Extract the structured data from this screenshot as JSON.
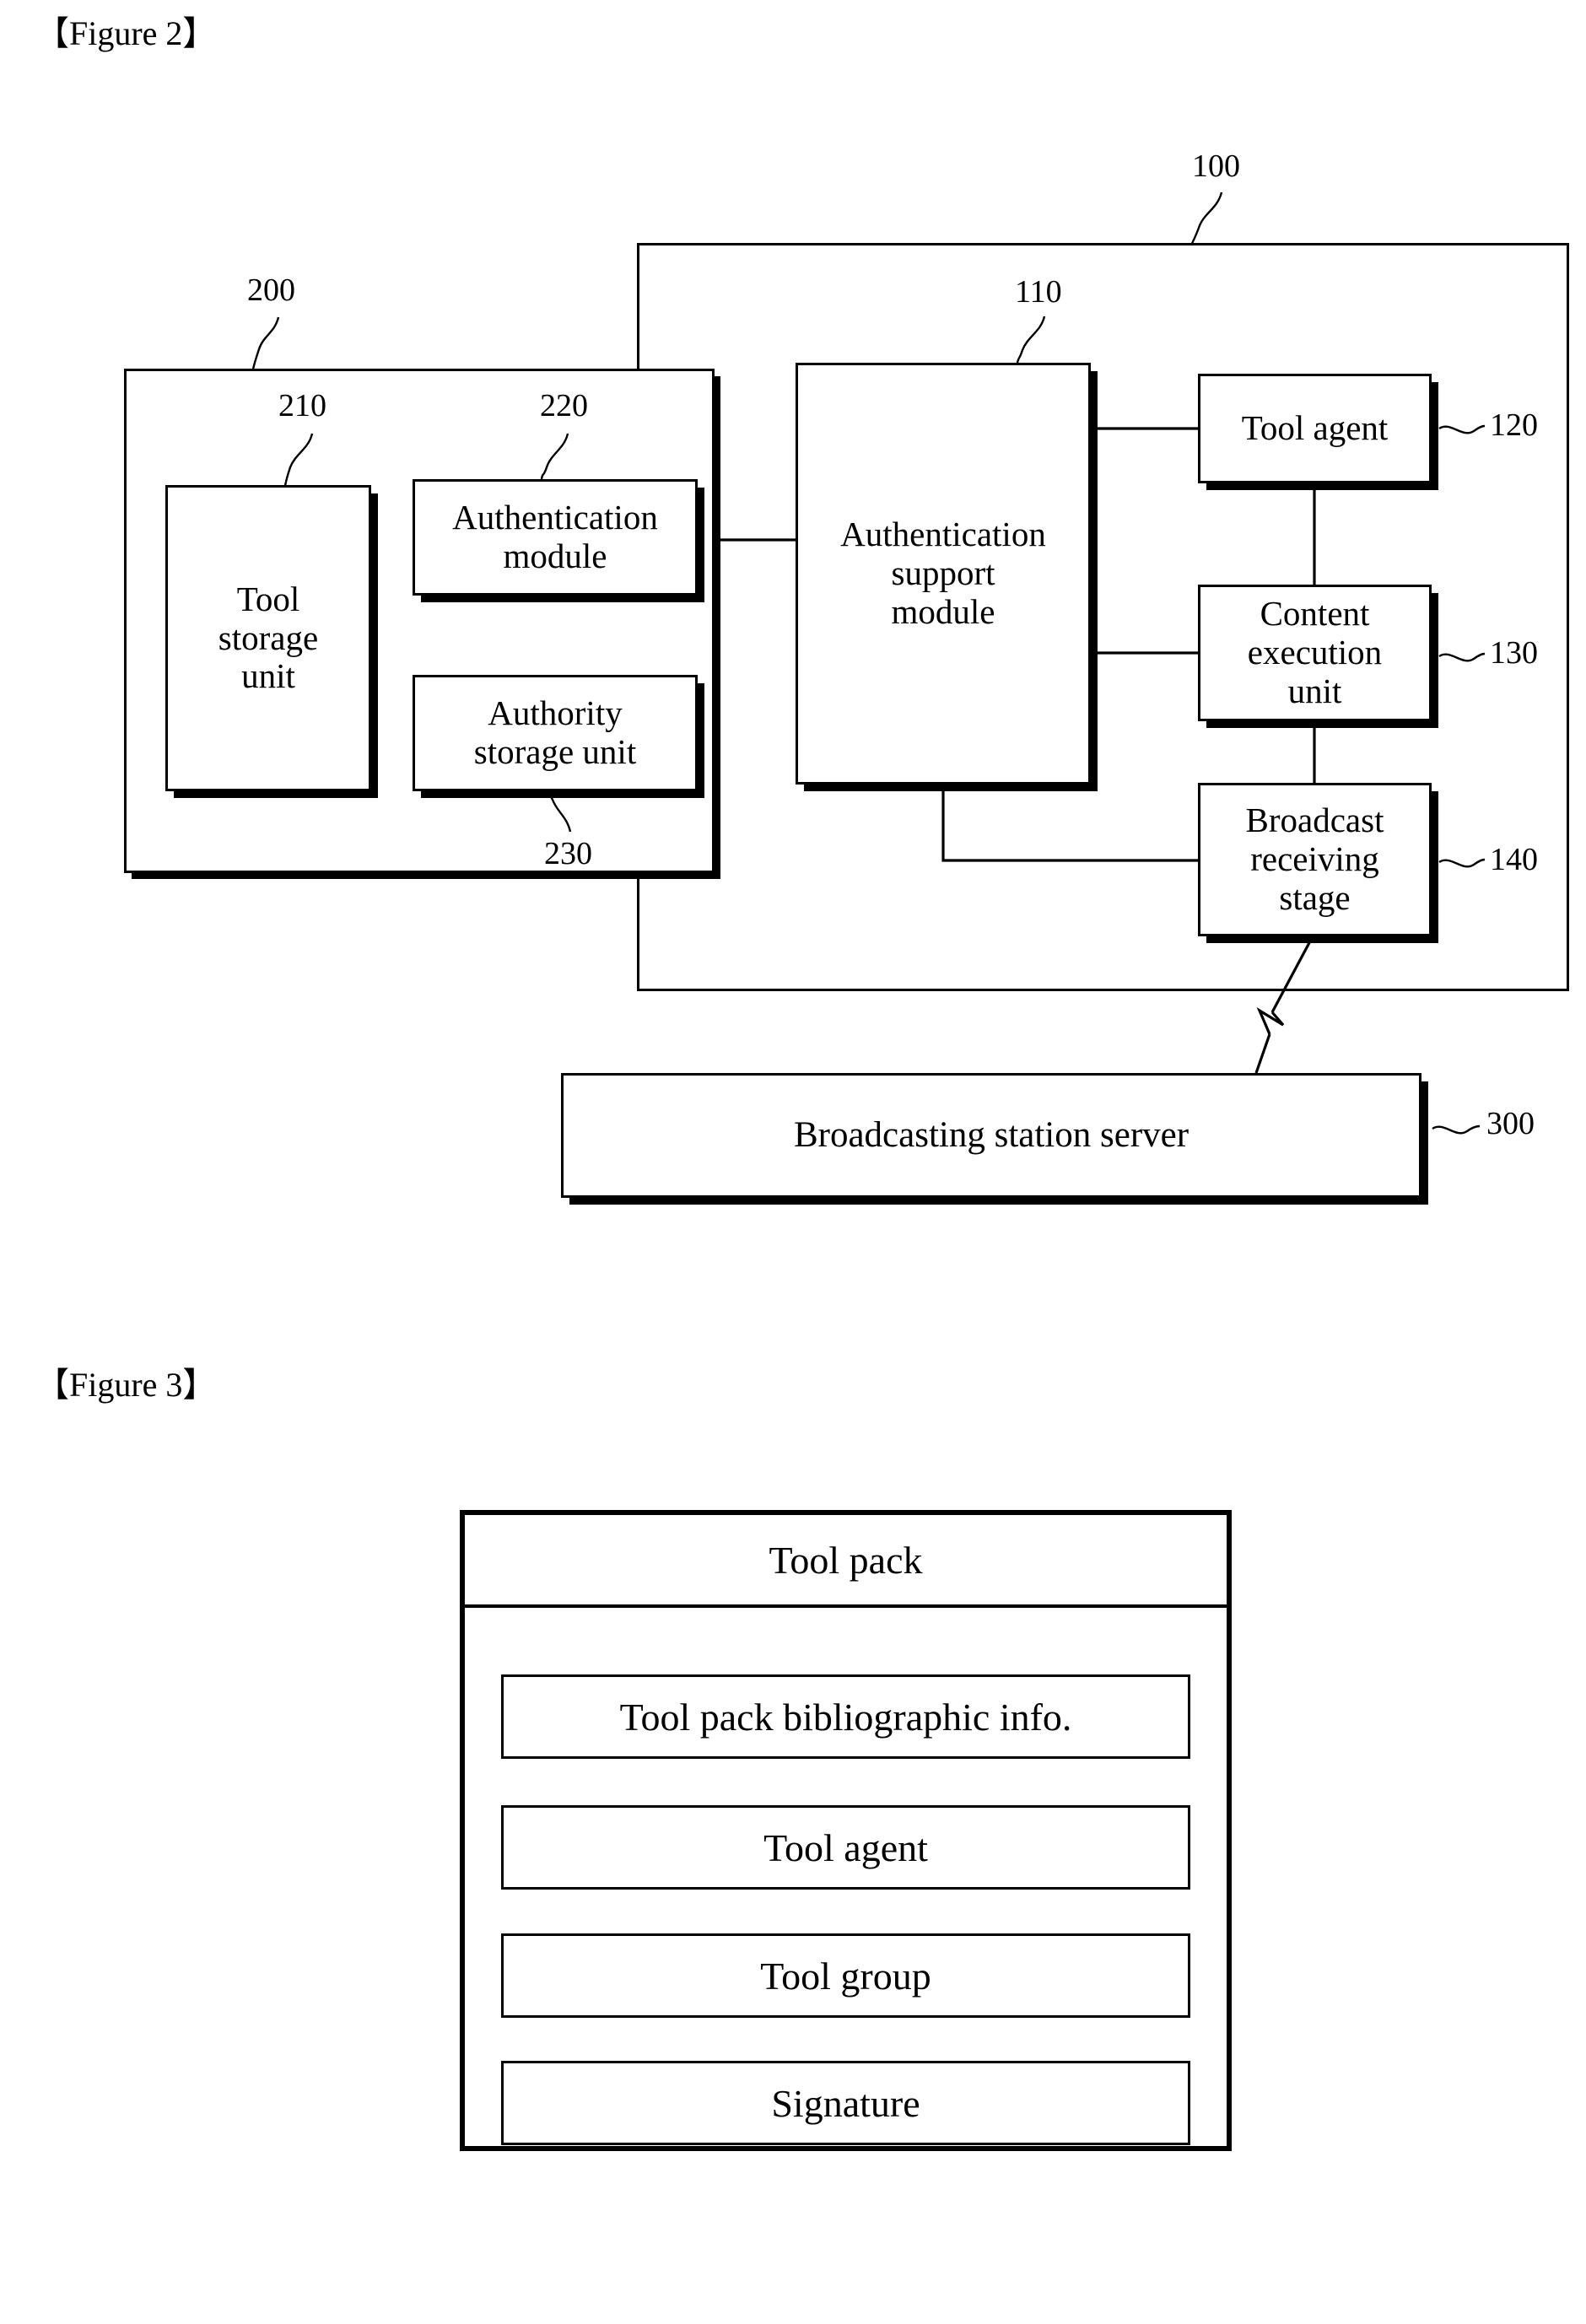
{
  "figure2": {
    "caption": "【Figure 2】",
    "containers": [
      {
        "ref": "200",
        "name": "tool-provider-container"
      },
      {
        "ref": "100",
        "name": "receiver-container"
      }
    ],
    "blocks": [
      {
        "ref": "210",
        "label": "Tool\nstorage\nunit",
        "name": "tool-storage-unit"
      },
      {
        "ref": "220",
        "label": "Authentication\nmodule",
        "name": "authentication-module"
      },
      {
        "ref": "230",
        "label": "Authority\nstorage unit",
        "name": "authority-storage-unit"
      },
      {
        "ref": "110",
        "label": "Authentication\nsupport\nmodule",
        "name": "authentication-support-module"
      },
      {
        "ref": "120",
        "label": "Tool agent",
        "name": "tool-agent"
      },
      {
        "ref": "130",
        "label": "Content\nexecution\nunit",
        "name": "content-execution-unit"
      },
      {
        "ref": "140",
        "label": "Broadcast\nreceiving\nstage",
        "name": "broadcast-receiving-stage"
      },
      {
        "ref": "300",
        "label": "Broadcasting station server",
        "name": "broadcasting-station-server"
      }
    ]
  },
  "figure3": {
    "caption": "【Figure 3】",
    "title": "Tool pack",
    "rows": [
      {
        "label": "Tool pack bibliographic info.",
        "name": "tool-pack-bibliographic-info"
      },
      {
        "label": "Tool agent",
        "name": "tool-pack-tool-agent"
      },
      {
        "label": "Tool group",
        "name": "tool-pack-tool-group"
      },
      {
        "label": "Signature",
        "name": "tool-pack-signature"
      }
    ]
  },
  "colors": {
    "ink": "#000000",
    "paper": "#ffffff"
  }
}
